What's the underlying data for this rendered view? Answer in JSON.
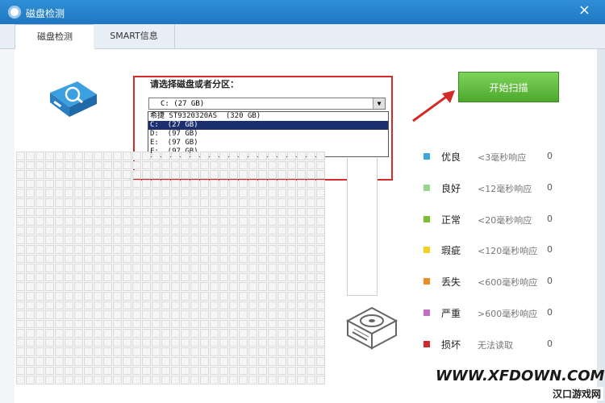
{
  "window": {
    "title": "磁盘检测"
  },
  "tabs": [
    {
      "label": "磁盘检测",
      "active": true
    },
    {
      "label": "SMART信息",
      "active": false
    }
  ],
  "disk_select": {
    "label": "请选择磁盘或者分区：",
    "current": "C:  (27 GB)",
    "options": [
      "希捷 ST9320320AS  (320 GB)",
      "C:  (27 GB)",
      "D:  (97 GB)",
      "E:  (97 GB)",
      "F:  (97 GB)"
    ],
    "highlighted_index": 1
  },
  "start_button": {
    "label": "开始扫描"
  },
  "legend": [
    {
      "name": "优良",
      "desc": "<3毫秒响应",
      "count": "0",
      "color": "#3aa7dd"
    },
    {
      "name": "良好",
      "desc": "<12毫秒响应",
      "count": "0",
      "color": "#9bd48f"
    },
    {
      "name": "正常",
      "desc": "<20毫秒响应",
      "count": "0",
      "color": "#7fbf2f"
    },
    {
      "name": "瑕疵",
      "desc": "<120毫秒响应",
      "count": "0",
      "color": "#f2d21d"
    },
    {
      "name": "丢失",
      "desc": "<600毫秒响应",
      "count": "0",
      "color": "#f08a1c"
    },
    {
      "name": "严重",
      "desc": ">600毫秒响应",
      "count": "0",
      "color": "#c46ec9"
    },
    {
      "name": "损坏",
      "desc": "无法读取",
      "count": "0",
      "color": "#d6262b"
    }
  ],
  "watermark": {
    "site": "WWW.XFDOWN.COM",
    "brand": "汉口游戏网"
  },
  "colors": {
    "titlebar": "#1f78c1",
    "highlight": "#d32a2a",
    "start_button": "#5ab636"
  }
}
